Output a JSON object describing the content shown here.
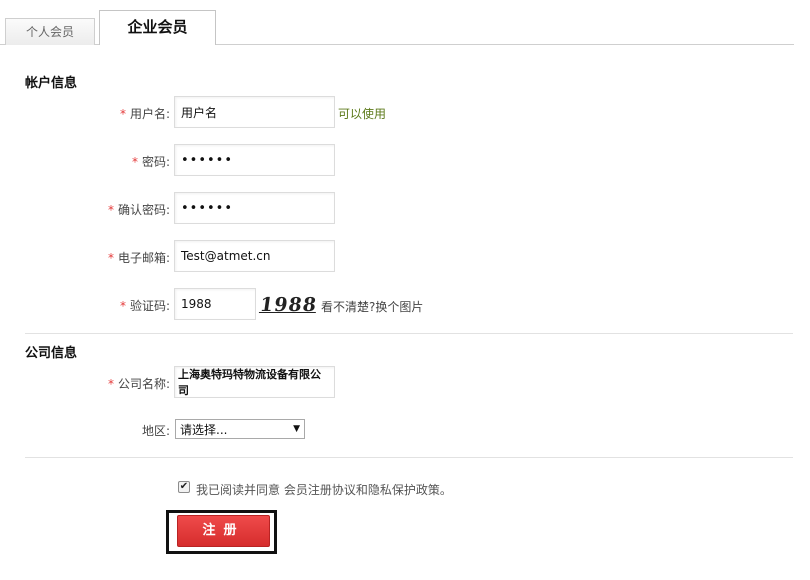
{
  "tabs": {
    "personal": "个人会员",
    "enterprise": "企业会员"
  },
  "account": {
    "section_title": "帐户信息",
    "username": {
      "label": "用户名:",
      "value": "用户名",
      "hint": "可以使用"
    },
    "password": {
      "label": "密码:",
      "value": "••••••"
    },
    "confirm_password": {
      "label": "确认密码:",
      "value": "••••••"
    },
    "email": {
      "label": "电子邮箱:",
      "value": "Test@atmet.cn"
    },
    "captcha": {
      "label": "验证码:",
      "value": "1988",
      "image_text": "1988",
      "refresh_link": "看不清楚?换个图片"
    }
  },
  "company": {
    "section_title": "公司信息",
    "name": {
      "label": "公司名称:",
      "value": "上海奥特玛特物流设备有限公司"
    },
    "region": {
      "label": "地区:",
      "selected": "请选择..."
    }
  },
  "agreement": {
    "text": "我已阅读并同意 会员注册协议和隐私保护政策。",
    "checked": true
  },
  "submit": {
    "label": "注册"
  },
  "colors": {
    "accent_red": "#e43a3a",
    "ok_green": "#5c7a1a",
    "button_red": "#dd3333"
  },
  "required_mark": "*"
}
